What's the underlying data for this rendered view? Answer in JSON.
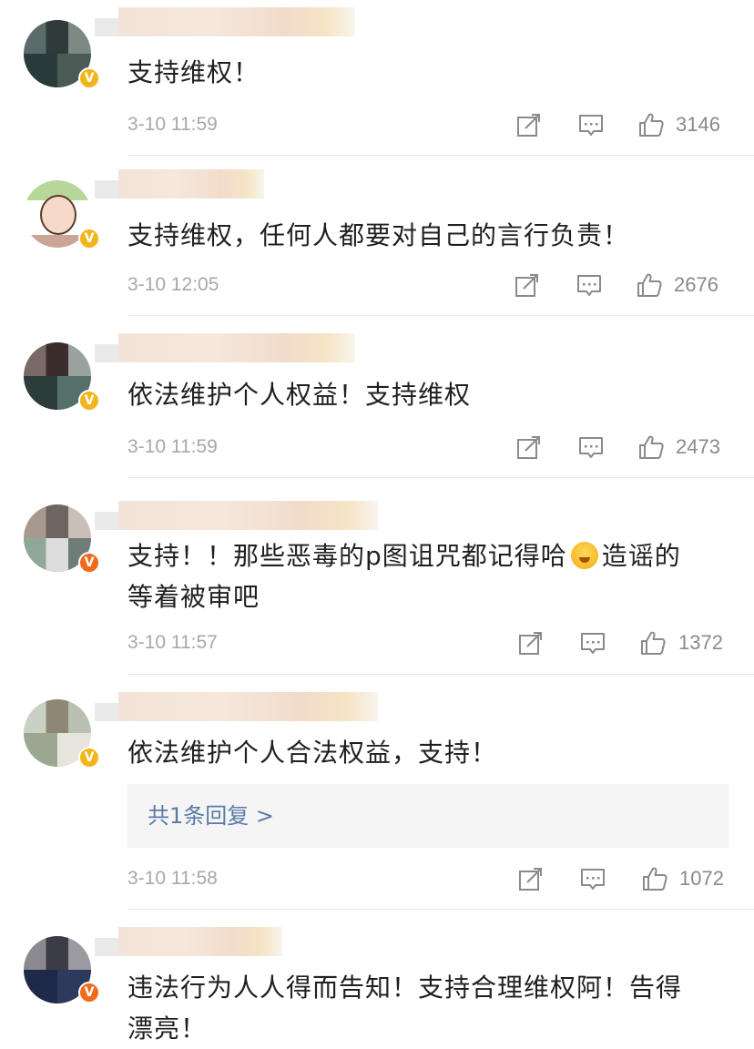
{
  "icon_names": {
    "share": "share-icon",
    "comment": "comment-icon",
    "like": "thumbs-up-icon",
    "verified": "verified-badge-icon",
    "emoji": "hug-emoji-icon"
  },
  "colors": {
    "time_text": "#a8a8a8",
    "reply_link": "#5a7aa6",
    "verified_gold": "#f3b51b",
    "verified_orange": "#f06a1a"
  },
  "comments": [
    {
      "text": "支持维权！",
      "time": "3-10 11:59",
      "likes": "3146",
      "verified": "V"
    },
    {
      "text": "支持维权，任何人都要对自己的言行负责！",
      "time": "3-10 12:05",
      "likes": "2676",
      "verified": "V"
    },
    {
      "text": "依法维护个人权益！支持维权",
      "time": "3-10 11:59",
      "likes": "2473",
      "verified": "V"
    },
    {
      "text_before": "支持！！那些恶毒的p图诅咒都记得哈",
      "text_after": "造谣的",
      "text_line2": "等着被审吧",
      "time": "3-10 11:57",
      "likes": "1372",
      "verified": "V"
    },
    {
      "text": "依法维护个人合法权益，支持！",
      "reply_link": "共1条回复 >",
      "time": "3-10 11:58",
      "likes": "1072",
      "verified": "V"
    },
    {
      "text_line1": "违法行为人人得而告知！支持合理维权阿！告得",
      "text_line2": "漂亮！",
      "verified": "V"
    }
  ]
}
